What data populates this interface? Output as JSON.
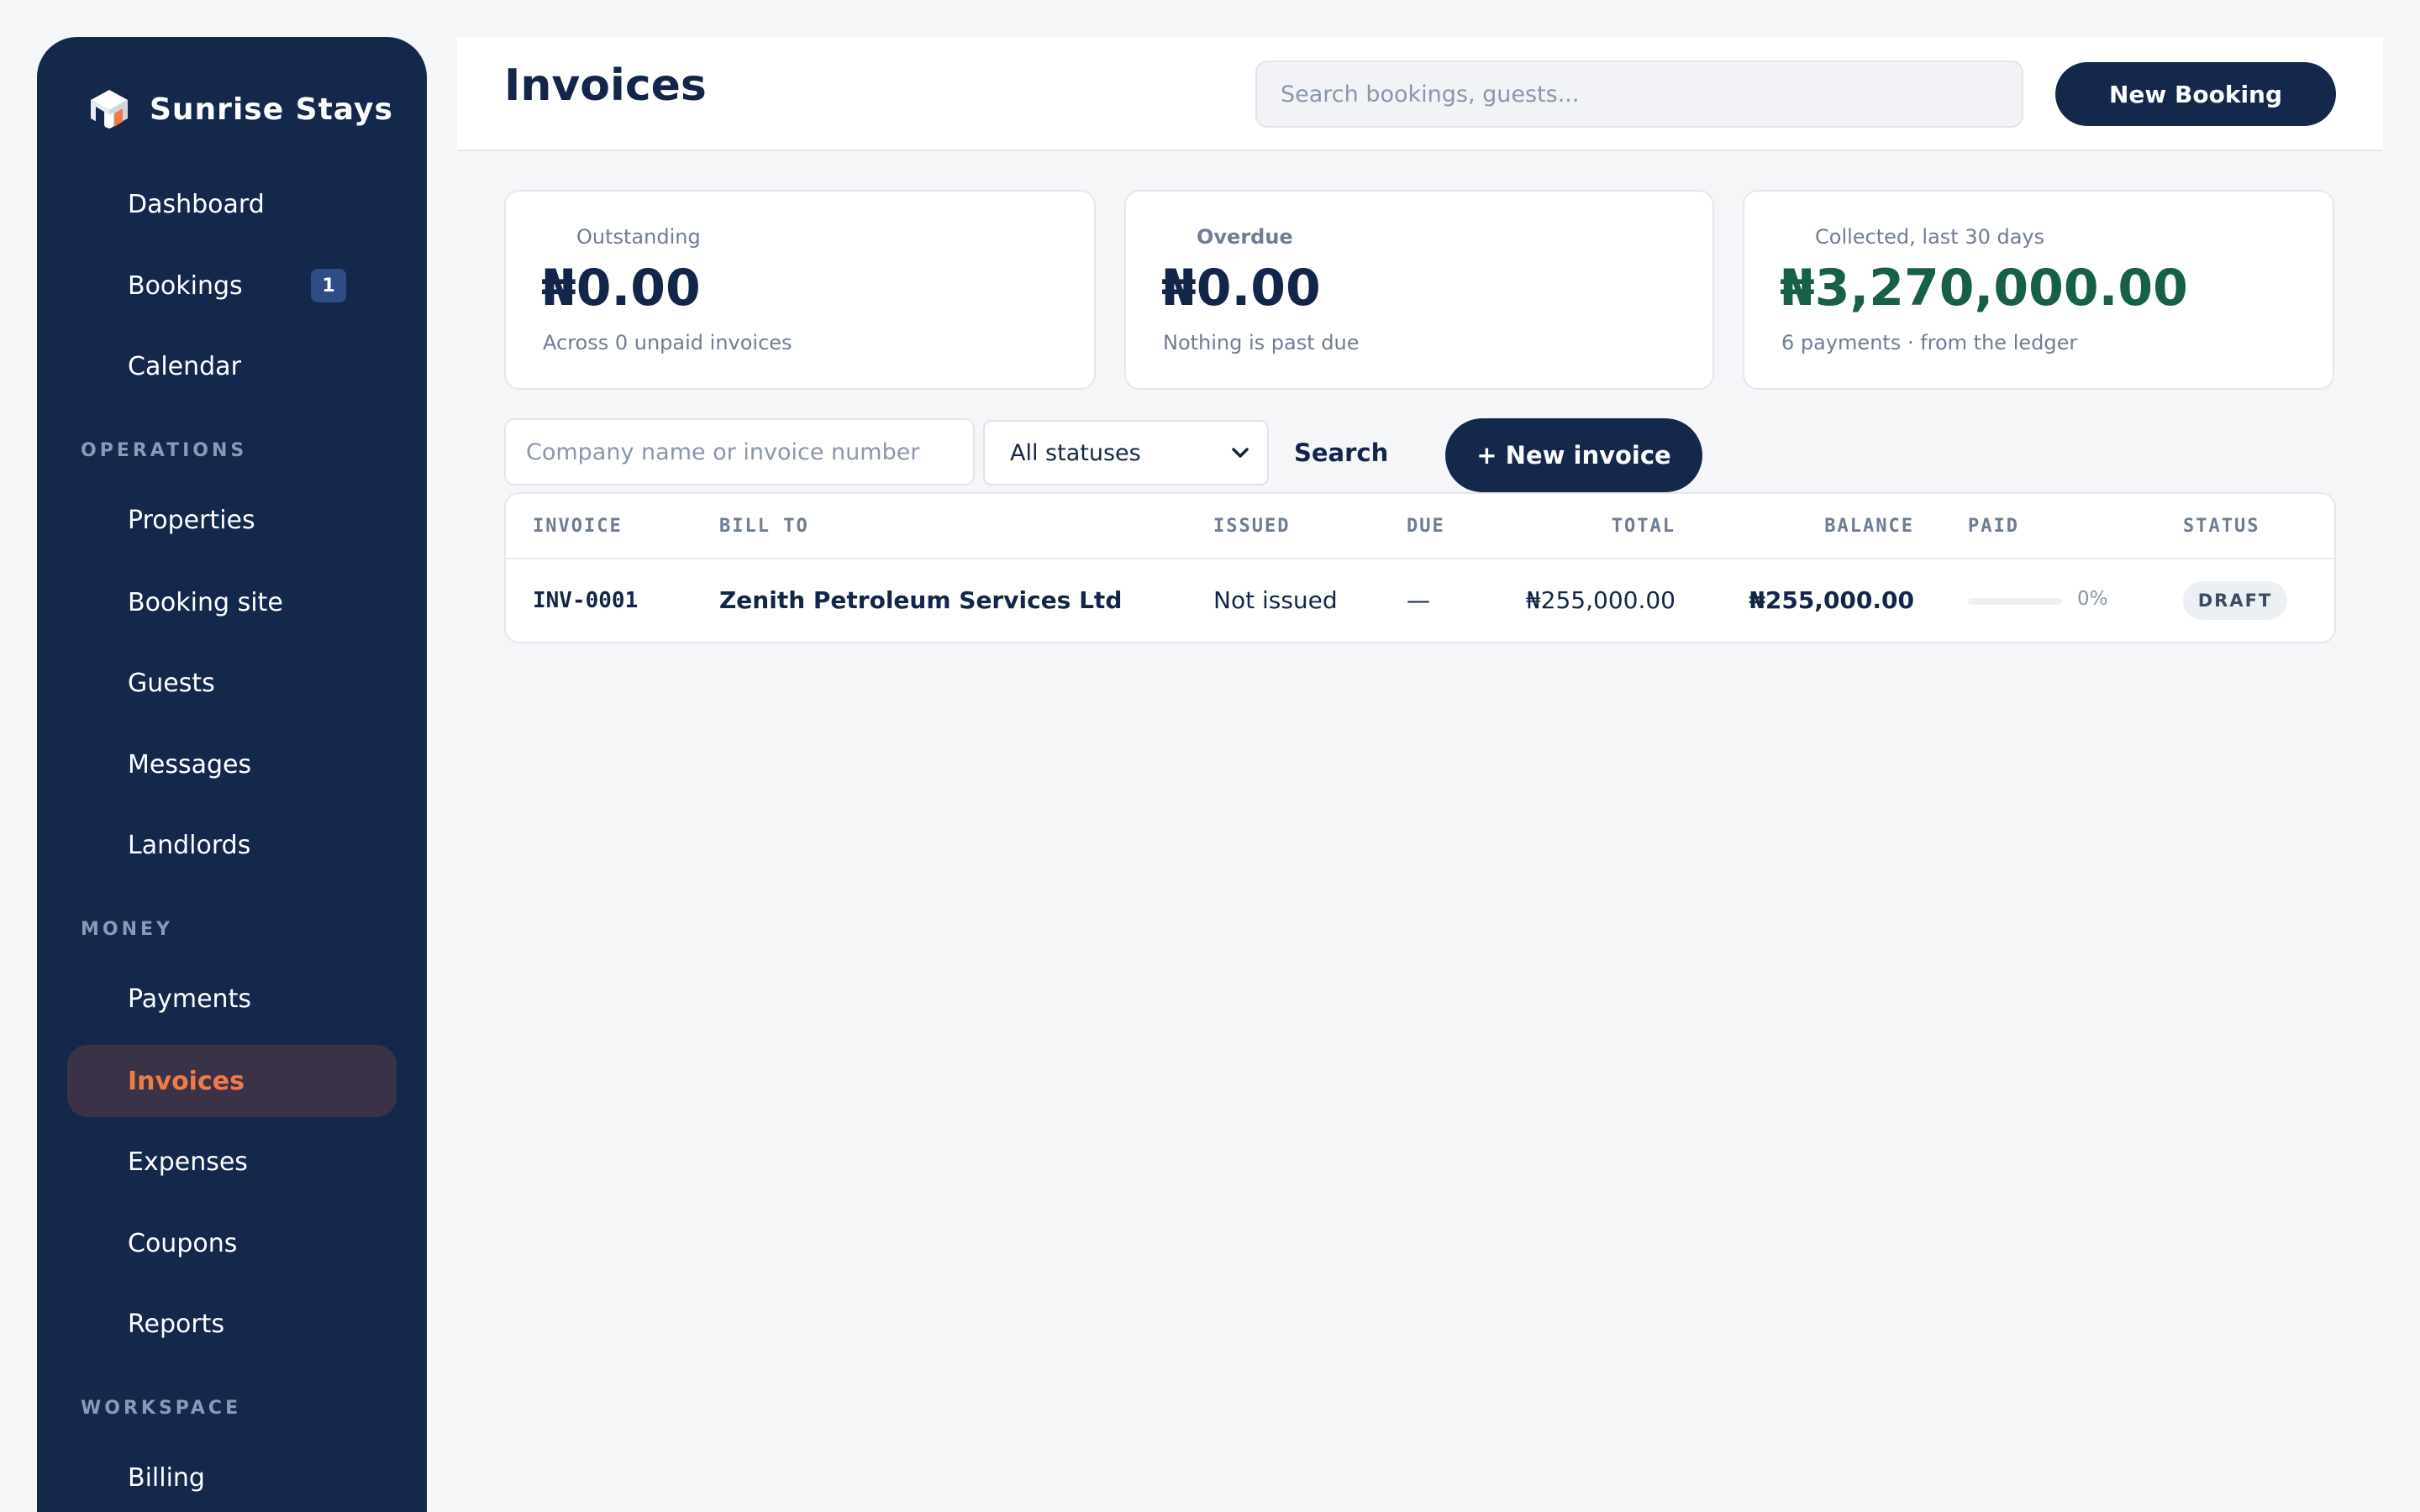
{
  "brand": {
    "name": "Sunrise Stays",
    "icon": "cube-logo-icon"
  },
  "sidebar": {
    "items": [
      {
        "label": "Dashboard"
      },
      {
        "label": "Bookings",
        "badge": "1"
      },
      {
        "label": "Calendar"
      },
      {
        "label": "Properties"
      },
      {
        "label": "Booking site"
      },
      {
        "label": "Guests"
      },
      {
        "label": "Messages"
      },
      {
        "label": "Landlords"
      },
      {
        "label": "Payments"
      },
      {
        "label": "Invoices",
        "active": true
      },
      {
        "label": "Expenses"
      },
      {
        "label": "Coupons"
      },
      {
        "label": "Reports"
      },
      {
        "label": "Billing"
      }
    ],
    "sections": [
      "OPERATIONS",
      "MONEY",
      "WORKSPACE"
    ]
  },
  "header": {
    "title": "Invoices",
    "search_placeholder": "Search bookings, guests...",
    "new_booking_label": "New Booking"
  },
  "stats": [
    {
      "label": "Outstanding",
      "value": "₦0.00",
      "sub": "Across 0 unpaid invoices"
    },
    {
      "label": "Overdue",
      "value": "₦0.00",
      "sub": "Nothing is past due"
    },
    {
      "label": "Collected, last 30 days",
      "value": "₦3,270,000.00",
      "sub": "6 payments · from the ledger"
    }
  ],
  "filters": {
    "query_placeholder": "Company name or invoice number",
    "status_selected": "All statuses",
    "search_label": "Search",
    "new_invoice_label": "+ New invoice"
  },
  "table": {
    "columns": [
      "INVOICE",
      "BILL TO",
      "ISSUED",
      "DUE",
      "TOTAL",
      "BALANCE",
      "PAID",
      "STATUS"
    ],
    "rows": [
      {
        "invoice": "INV-0001",
        "bill_to": "Zenith Petroleum Services Ltd",
        "issued": "Not issued",
        "due": "—",
        "total": "₦255,000.00",
        "balance": "₦255,000.00",
        "paid_fraction": 0,
        "paid_pct": "0%",
        "status": "DRAFT"
      }
    ]
  },
  "colors": {
    "sidebar_bg": "#14284b",
    "accent": "#f07b45",
    "positive": "#166046",
    "page_bg": "#f5f6f8"
  }
}
